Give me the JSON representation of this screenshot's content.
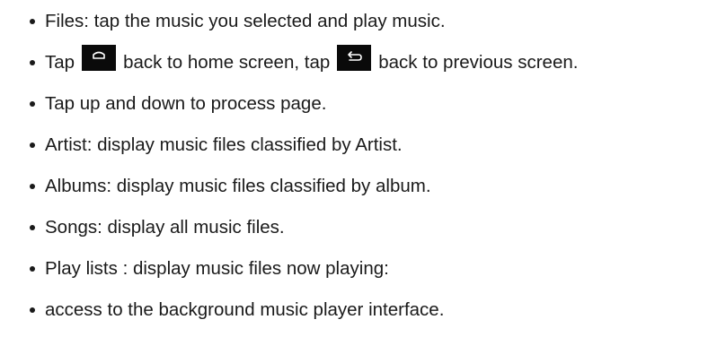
{
  "items": [
    {
      "text": "Files: tap the music you selected and play music."
    },
    {
      "part1": "Tap",
      "icon1": "home-key-icon",
      "part2": "back to home screen, tap",
      "icon2": "back-key-icon",
      "part3": "back to previous screen."
    },
    {
      "text": "Tap up and down to process page."
    },
    {
      "text": "Artist: display music files classified by Artist."
    },
    {
      "text": "Albums: display music files classified by album."
    },
    {
      "text": "Songs: display all music files."
    },
    {
      "text": "Play lists : display music files now playing:"
    },
    {
      "text": "access to the background music player interface."
    }
  ]
}
